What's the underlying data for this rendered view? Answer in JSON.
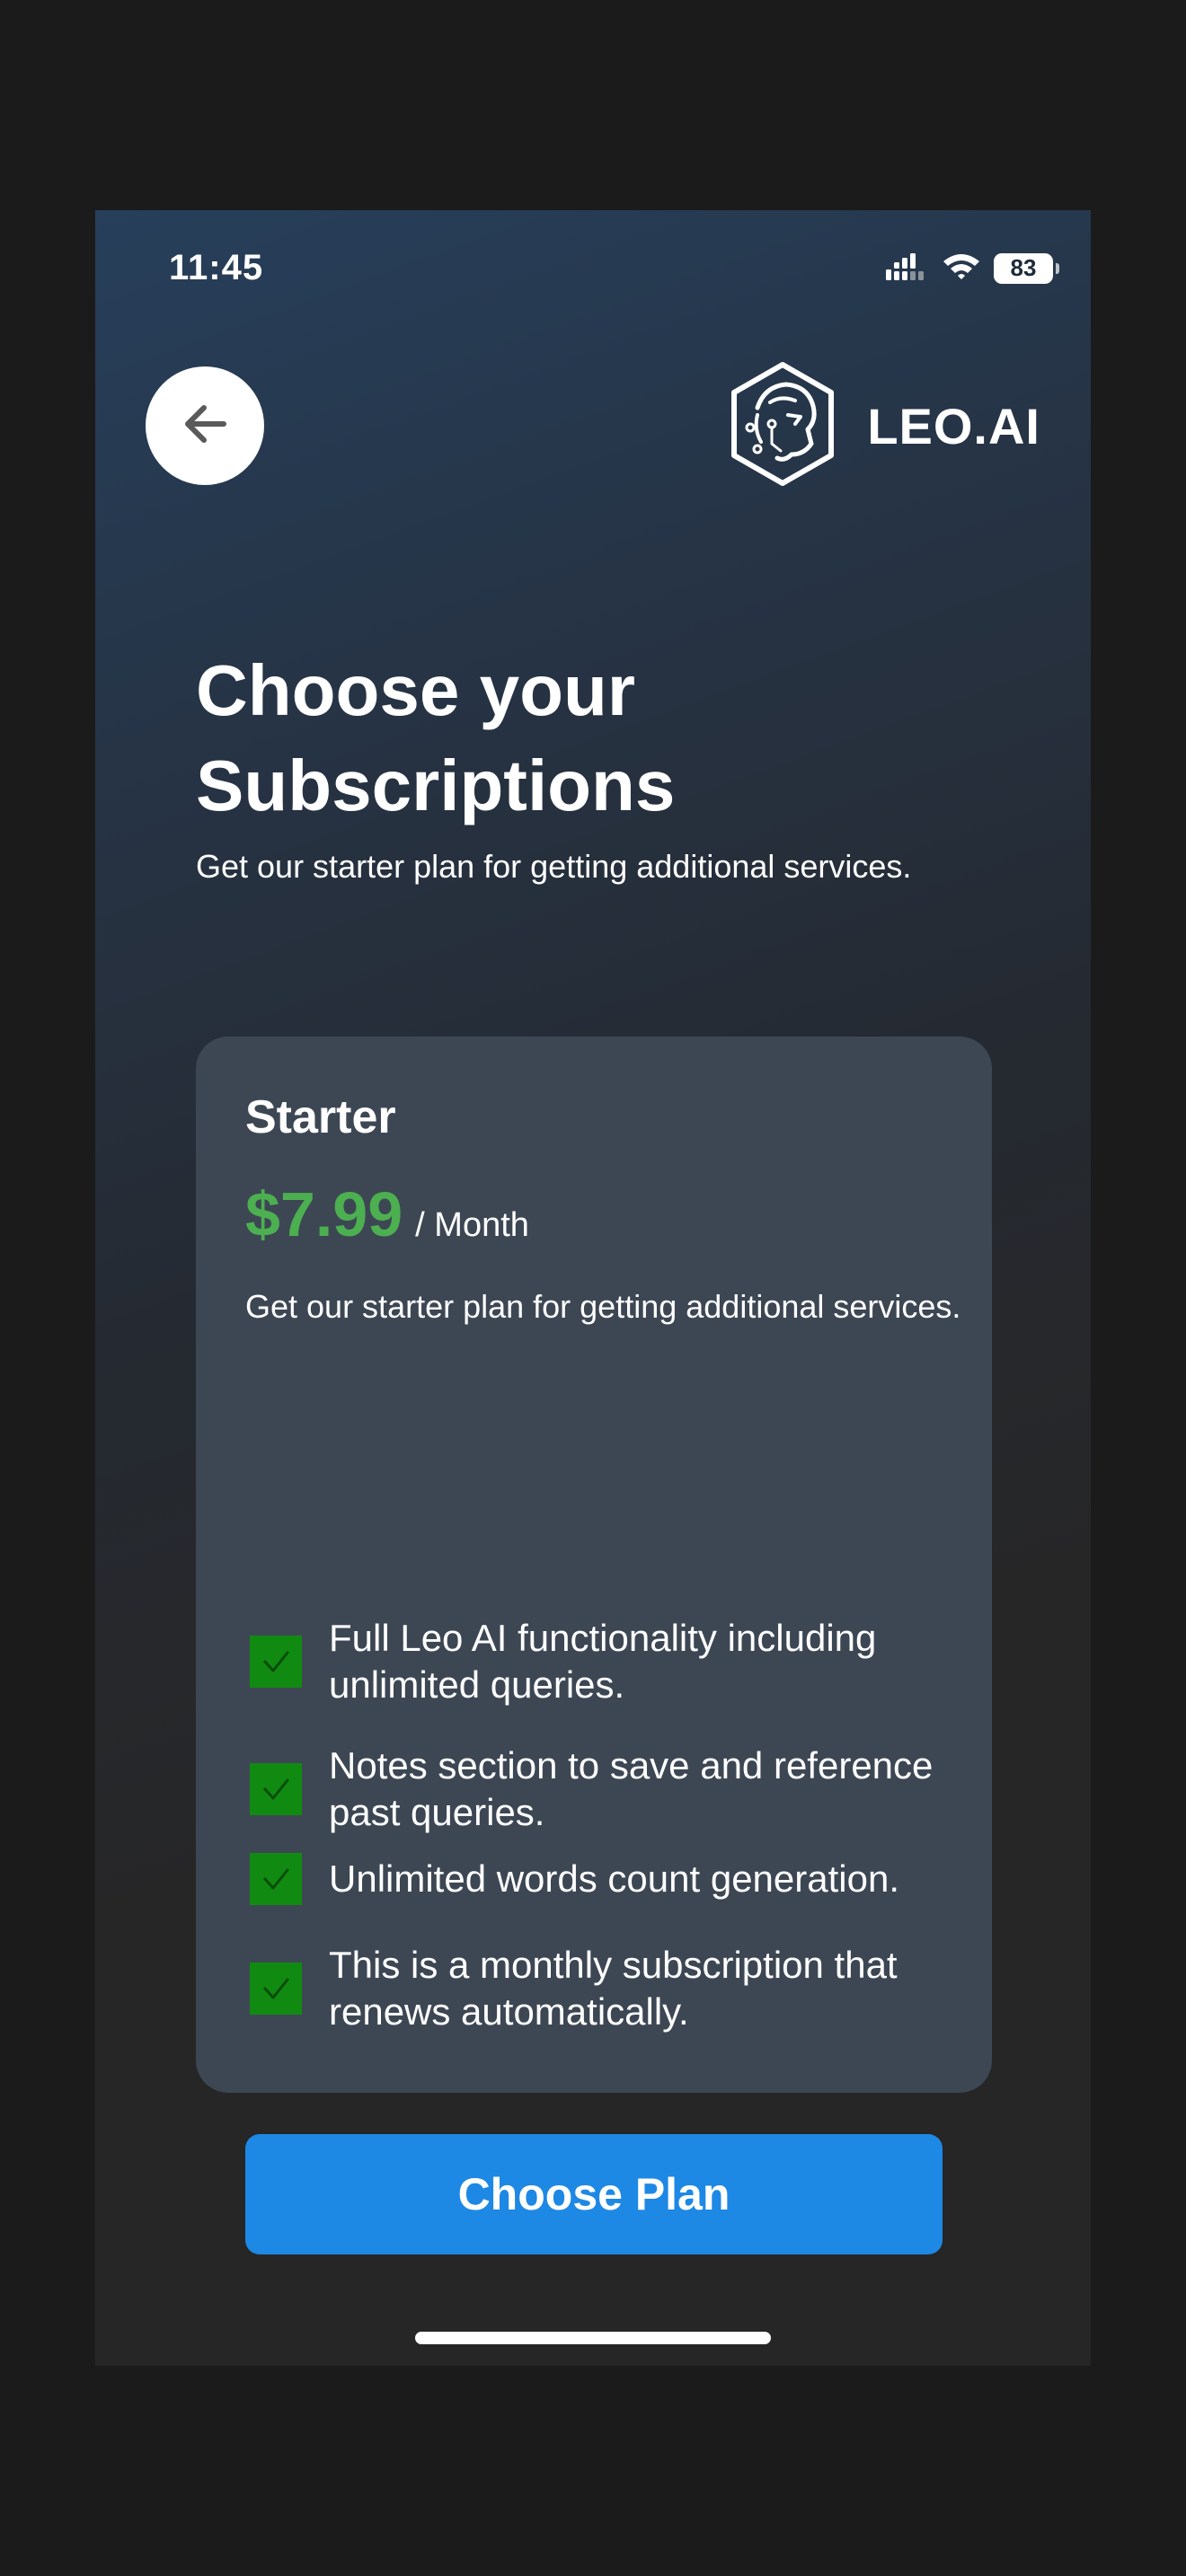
{
  "status_bar": {
    "time": "11:45",
    "battery": "83"
  },
  "header": {
    "brand_name": "LEO.AI"
  },
  "page": {
    "title_line1": "Choose your",
    "title_line2": "Subscriptions",
    "subtitle": "Get our starter plan for getting additional services."
  },
  "plan": {
    "name": "Starter",
    "price": "$7.99",
    "period": "/ Month",
    "description": "Get our starter plan for getting additional services.",
    "features": [
      "Full Leo AI functionality including unlimited queries.",
      "Notes section to save and reference past queries.",
      "Unlimited words count generation.",
      "This is a monthly subscription that renews automatically."
    ],
    "cta_label": "Choose Plan"
  },
  "colors": {
    "price_accent": "#4caf50",
    "cta_background": "#1e88e5",
    "checkbox": "#118a11",
    "card_background": "#3d4754"
  }
}
